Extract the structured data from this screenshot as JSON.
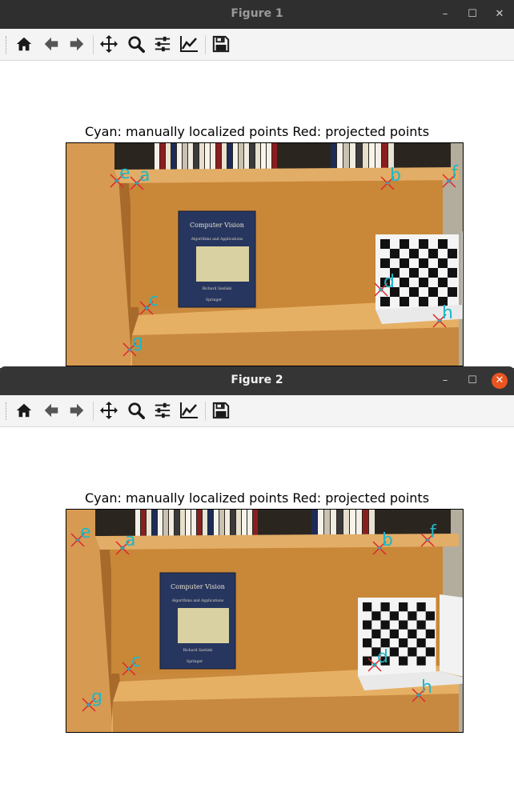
{
  "windows": [
    {
      "title": "Figure 1",
      "plot_title": "Cyan: manually localized points   Red: projected points",
      "points": [
        {
          "label": "e"
        },
        {
          "label": "a"
        },
        {
          "label": "b"
        },
        {
          "label": "f"
        },
        {
          "label": "d"
        },
        {
          "label": "c"
        },
        {
          "label": "h"
        },
        {
          "label": "g"
        }
      ]
    },
    {
      "title": "Figure 2",
      "plot_title": "Cyan: manually localized points   Red: projected points",
      "points": [
        {
          "label": "e"
        },
        {
          "label": "a"
        },
        {
          "label": "b"
        },
        {
          "label": "f"
        },
        {
          "label": "d"
        },
        {
          "label": "c"
        },
        {
          "label": "h"
        },
        {
          "label": "g"
        }
      ]
    }
  ],
  "window_controls": {
    "minimize": "–",
    "maximize": "☐",
    "close": "✕"
  },
  "toolbar_icons": [
    "home-icon",
    "back-arrow-icon",
    "forward-arrow-icon",
    "pan-move-icon",
    "zoom-icon",
    "configure-subplots-icon",
    "edit-axes-icon",
    "save-icon"
  ],
  "book": {
    "title": "Computer Vision",
    "subtitle": "Algorithms and Applications",
    "author": "Richard Szeliski",
    "publisher": "Springer"
  },
  "colors": {
    "manual_points": "#1fb7c7",
    "projected_points": "#e0262b"
  }
}
